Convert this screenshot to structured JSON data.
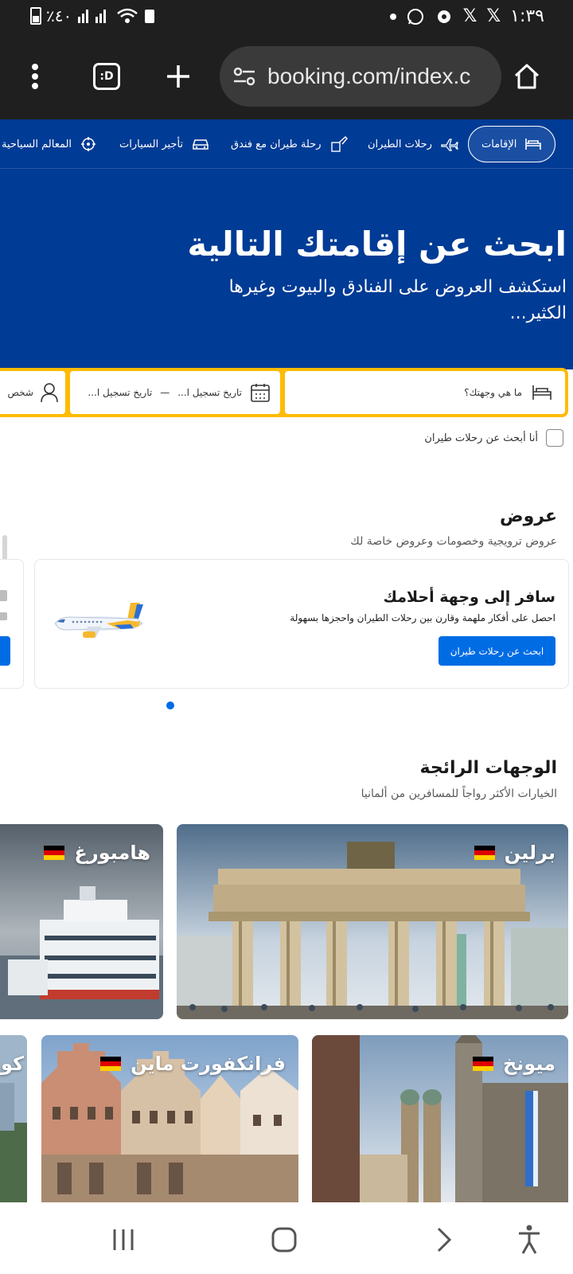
{
  "status_bar": {
    "battery_percent": "٪٤٠",
    "time": "١:٣٩"
  },
  "browser": {
    "url": "booking.com/index.c",
    "tab_switcher_label": ":D"
  },
  "nav": {
    "items": [
      {
        "label": "الإقامات",
        "icon": "bed-icon",
        "active": true
      },
      {
        "label": "رحلات الطيران",
        "icon": "plane-icon",
        "active": false
      },
      {
        "label": "رحلة طيران مع فندق",
        "icon": "plane-hotel-icon",
        "active": false
      },
      {
        "label": "تأجير السيارات",
        "icon": "car-icon",
        "active": false
      },
      {
        "label": "المعالم السياحية",
        "icon": "attractions-icon",
        "active": false
      }
    ]
  },
  "hero": {
    "title": "ابحث عن إقامتك التالية",
    "subtitle": "استكشف العروض على الفنادق والبيوت وغيرها الكثير..."
  },
  "search": {
    "destination_placeholder": "ما هي وجهتك؟",
    "checkin_label": "تاريخ تسجيل ا...",
    "date_separator": "—",
    "checkout_label": "تاريخ تسجيل ا...",
    "guests_label": "شخص",
    "flights_checkbox_label": "أنا أبحث عن رحلات طيران"
  },
  "offers": {
    "title": "عروض",
    "subtitle": "عروض ترويجية وخصومات وعروض خاصة لك",
    "card": {
      "title": "سافر إلى وجهة أحلامك",
      "text": "احصل على أفكار ملهمة وقارن بين رحلات الطيران واحجزها بسهولة",
      "button": "ابحث عن رحلات طيران"
    }
  },
  "trending": {
    "title": "الوجهات الرائجة",
    "subtitle": "الخيارات الأكثر رواجاً للمسافرين من ألمانيا",
    "destinations": [
      {
        "name": "برلين",
        "flag": "germany-flag-icon"
      },
      {
        "name": "هامبورغ",
        "flag": "germany-flag-icon"
      },
      {
        "name": "ميونخ",
        "flag": "germany-flag-icon"
      },
      {
        "name": "فرانكفورت ماين",
        "flag": "germany-flag-icon"
      },
      {
        "name": "كو",
        "flag": "germany-flag-icon"
      }
    ]
  },
  "colors": {
    "brand_blue": "#003b95",
    "search_yellow": "#febb02",
    "button_blue": "#006ce4"
  }
}
